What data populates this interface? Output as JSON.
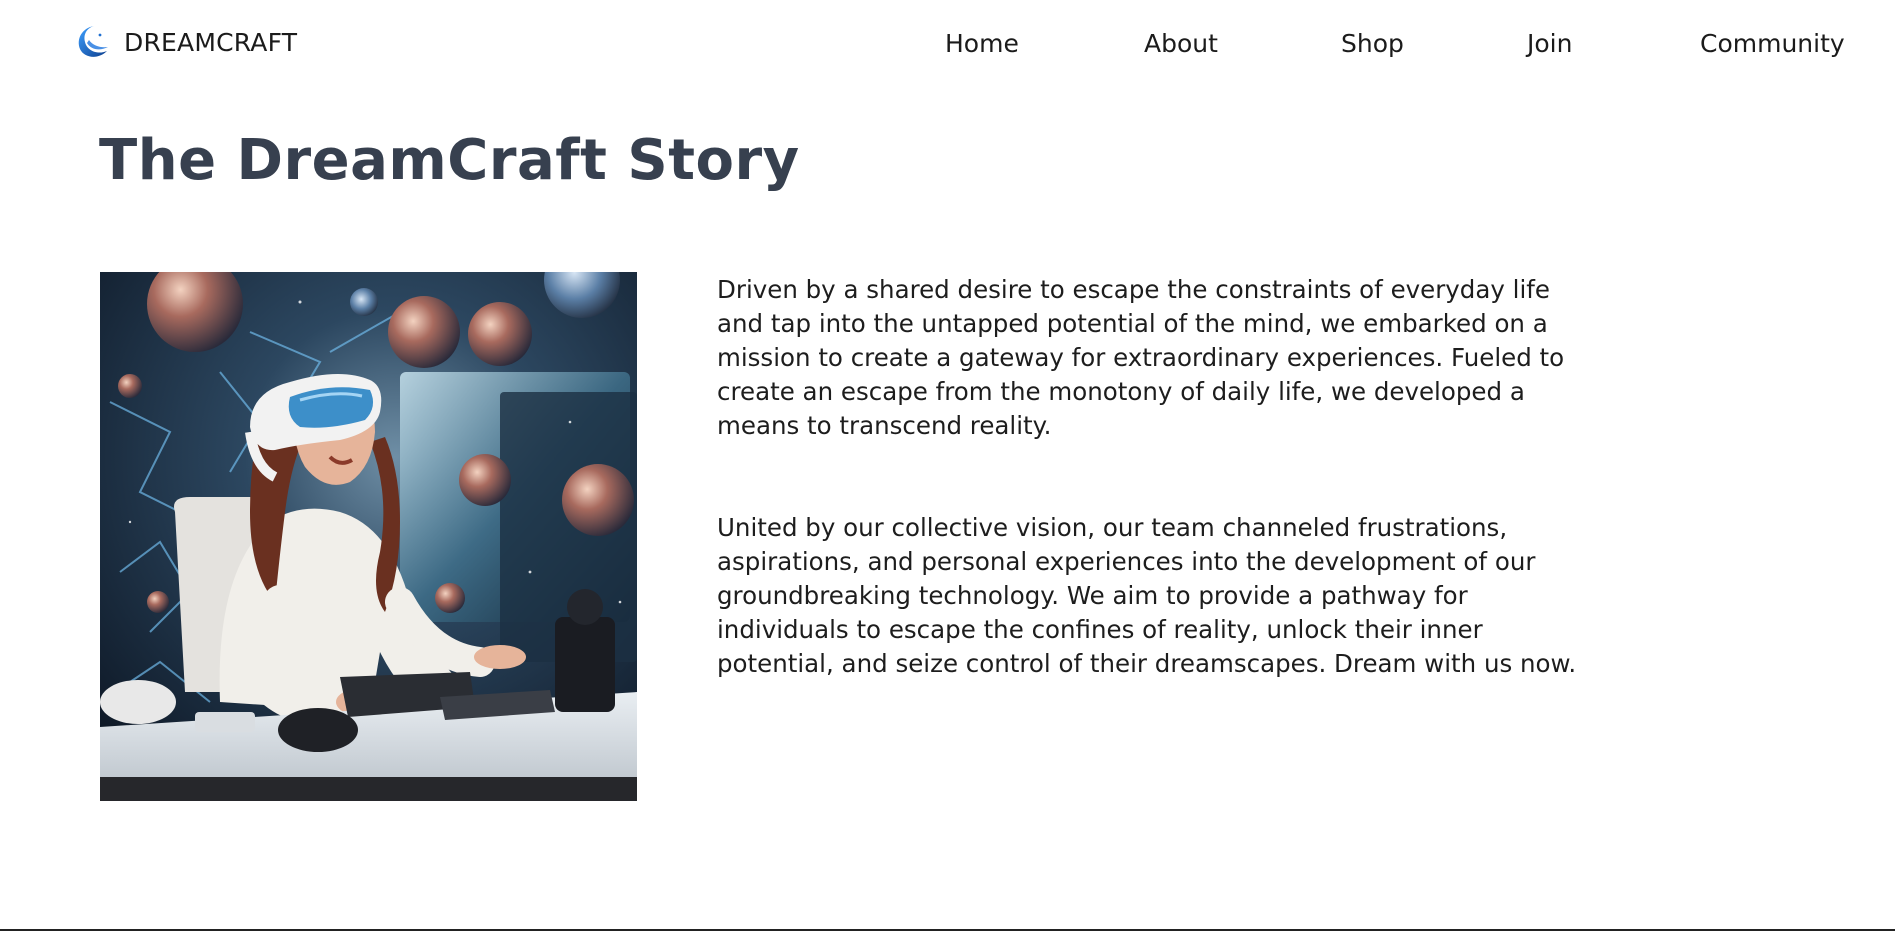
{
  "header": {
    "brand_name": "DREAMCRAFT",
    "brand_icon": "crescent-moon-logo",
    "nav": [
      {
        "label": "Home"
      },
      {
        "label": "About"
      },
      {
        "label": "Shop"
      },
      {
        "label": "Join"
      },
      {
        "label": "Community"
      }
    ]
  },
  "main": {
    "title": "The DreamCraft Story",
    "paragraphs": [
      "Driven by a shared desire to escape the constraints of everyday life and tap into the untapped potential of the mind, we embarked on a mission to create a gateway for extraordinary experiences. Fueled to create an escape from the monotony of daily life, we developed a means to transcend reality.",
      "United by our collective vision, our team channeled frustrations, aspirations, and personal experiences into the development of our groundbreaking technology. We aim to provide a pathway for individuals to escape the confines of reality, unlock their inner potential, and seize control of their dreamscapes. Dream with us now."
    ],
    "image": "woman-wearing-vr-headset-at-desk-with-floating-planets"
  },
  "colors": {
    "title": "#37404f",
    "text": "#1d1d1d",
    "logo_blue": "#1f6fd1",
    "background": "#ffffff"
  }
}
